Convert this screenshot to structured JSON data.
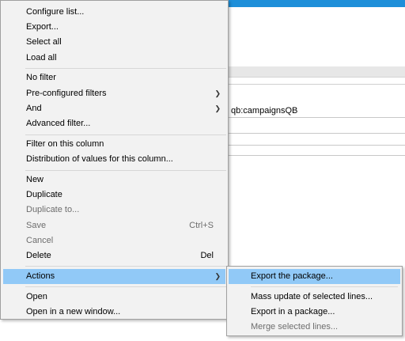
{
  "background": {
    "cell_value": "qb:campaignsQB"
  },
  "menu": {
    "items": [
      {
        "label": "Configure list..."
      },
      {
        "label": "Export..."
      },
      {
        "label": "Select all"
      },
      {
        "label": "Load all"
      },
      {
        "label": "No filter"
      },
      {
        "label": "Pre-configured filters"
      },
      {
        "label": "And"
      },
      {
        "label": "Advanced filter..."
      },
      {
        "label": "Filter on this column"
      },
      {
        "label": "Distribution of values for this column..."
      },
      {
        "label": "New"
      },
      {
        "label": "Duplicate"
      },
      {
        "label": "Duplicate to..."
      },
      {
        "label": "Save",
        "shortcut": "Ctrl+S"
      },
      {
        "label": "Cancel"
      },
      {
        "label": "Delete",
        "shortcut": "Del"
      },
      {
        "label": "Actions"
      },
      {
        "label": "Open"
      },
      {
        "label": "Open in a new window..."
      }
    ]
  },
  "submenu": {
    "items": [
      {
        "label": "Export the package..."
      },
      {
        "label": "Mass update of selected lines..."
      },
      {
        "label": "Export in a package..."
      },
      {
        "label": "Merge selected lines..."
      }
    ]
  },
  "colors": {
    "highlight": "#91c9f7",
    "titlebar": "#1e8fd9"
  }
}
